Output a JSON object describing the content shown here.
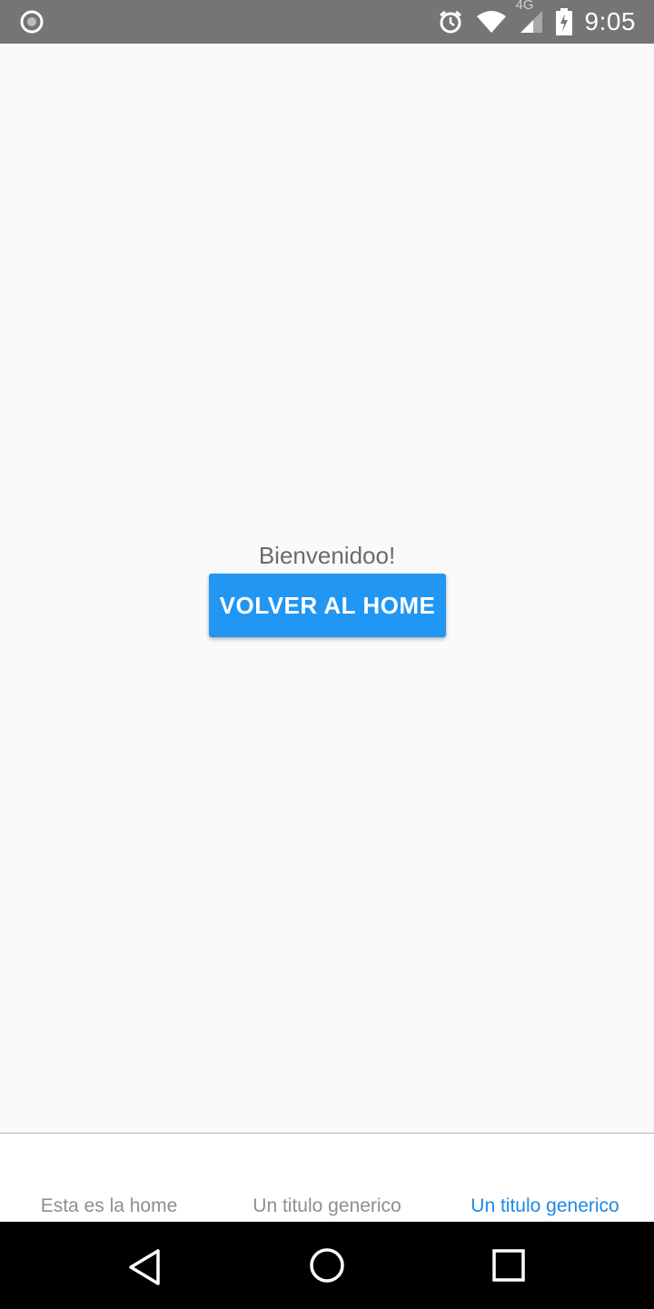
{
  "status_bar": {
    "network_label": "4G",
    "time": "9:05",
    "icons": [
      "record-icon",
      "alarm-icon",
      "wifi-icon",
      "cellular-signal-icon",
      "battery-charging-icon"
    ]
  },
  "main": {
    "welcome_text": "Bienvenidoo!",
    "home_button_label": "VOLVER AL HOME"
  },
  "tab_bar": {
    "tabs": [
      {
        "label": "Esta es la home",
        "active": false
      },
      {
        "label": "Un titulo generico",
        "active": false
      },
      {
        "label": "Un titulo generico",
        "active": true
      }
    ]
  },
  "nav_bar": {
    "icons": [
      "back-icon",
      "home-icon",
      "recents-icon"
    ]
  },
  "colors": {
    "accent": "#2196f3",
    "active_tab": "#1e88e5",
    "status_bar": "#757575",
    "background": "#fafafa"
  }
}
